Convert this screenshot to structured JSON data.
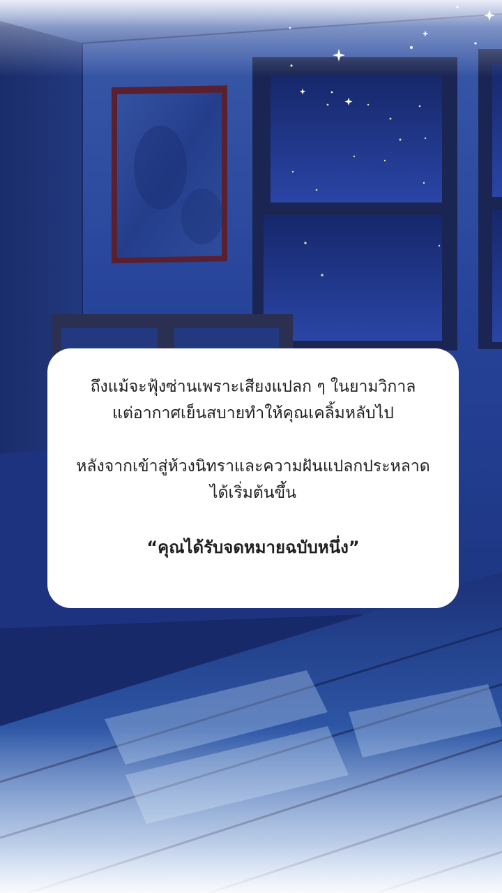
{
  "dialog": {
    "paragraph_1": [
      "ถึงแม้จะฟุ้งซ่านเพราะเสียงแปลก ๆ ในยามวิกาล",
      "แต่อากาศเย็นสบายทำให้คุณเคลิ้มหลับไป"
    ],
    "paragraph_2": [
      "หลังจากเข้าสู่ห้วงนิทราและความฝันแปลกประหลาด",
      "ได้เริ่มต้นขึ้น"
    ],
    "quote": "“คุณได้รับจดหมายฉบับหนึ่ง”"
  },
  "scene": {
    "description_colors": {
      "night_blue": "#1a2f78",
      "wall_blue": "#23408f",
      "window_frame": "#1b2553",
      "mirror_frame": "#5a2030",
      "floor_light": "#9fc2ec"
    }
  }
}
